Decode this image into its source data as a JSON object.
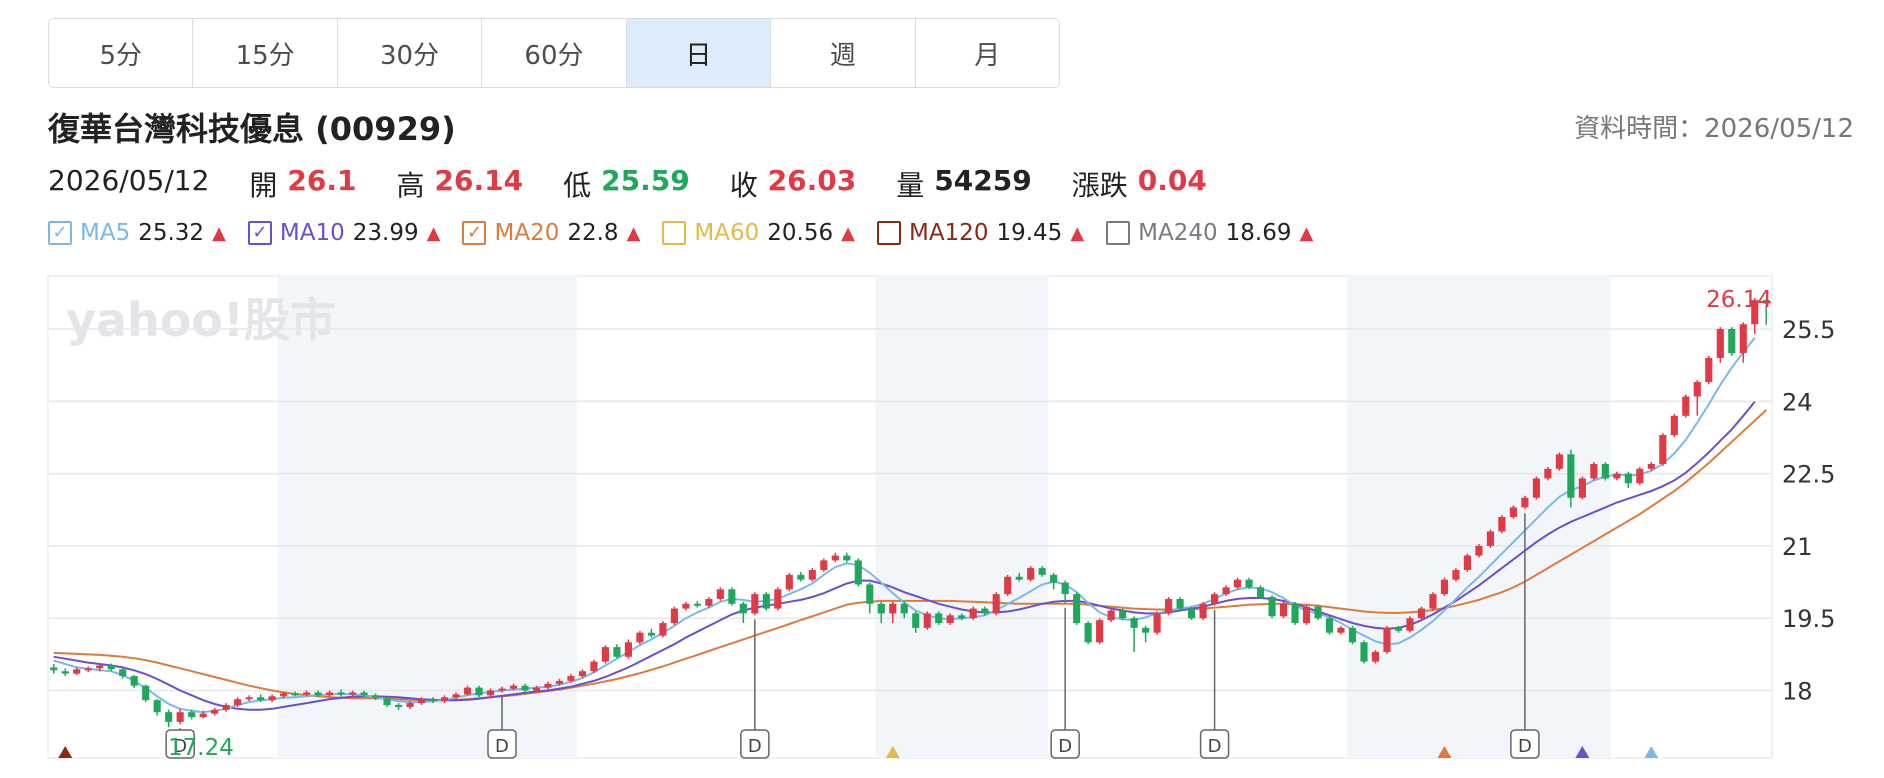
{
  "tabs": [
    {
      "label": "5分",
      "active": false
    },
    {
      "label": "15分",
      "active": false
    },
    {
      "label": "30分",
      "active": false
    },
    {
      "label": "60分",
      "active": false
    },
    {
      "label": "日",
      "active": true
    },
    {
      "label": "週",
      "active": false
    },
    {
      "label": "月",
      "active": false
    }
  ],
  "stock": {
    "title": "復華台灣科技優息 (00929)",
    "timestamp_label": "資料時間：2026/05/12"
  },
  "quote": {
    "date": "2026/05/12",
    "open_label": "開",
    "open": "26.1",
    "high_label": "高",
    "high": "26.14",
    "low_label": "低",
    "low": "25.59",
    "close_label": "收",
    "close": "26.03",
    "volume_label": "量",
    "volume": "54259",
    "change_label": "漲跌",
    "change": "0.04"
  },
  "legend": [
    {
      "name": "MA5",
      "value": "25.32",
      "checked": true,
      "color": "#7ab8ea"
    },
    {
      "name": "MA10",
      "value": "23.99",
      "checked": true,
      "color": "#6a4fd0"
    },
    {
      "name": "MA20",
      "value": "22.8",
      "checked": true,
      "color": "#e07a3a"
    },
    {
      "name": "MA60",
      "value": "20.56",
      "checked": false,
      "color": "#e6b84a"
    },
    {
      "name": "MA120",
      "value": "19.45",
      "checked": false,
      "color": "#8a2a12"
    },
    {
      "name": "MA240",
      "value": "18.69",
      "checked": false,
      "color": "#777b80"
    }
  ],
  "colors": {
    "up": "#e03a44",
    "down": "#1fa85a",
    "dark": "#222222",
    "band": "#f2f6fa",
    "grid": "#e4e8ec"
  },
  "watermark": "yahoo!股市",
  "chart_data": {
    "type": "candlestick",
    "ylim": [
      16.6,
      26.6
    ],
    "yticks": [
      "18",
      "19.5",
      "21",
      "22.5",
      "24",
      "25.5"
    ],
    "max_label": "26.14",
    "min_label": "17.24",
    "candles": [
      [
        18.48,
        18.42,
        18.55,
        18.35
      ],
      [
        18.4,
        18.35,
        18.46,
        18.3
      ],
      [
        18.35,
        18.44,
        18.48,
        18.32
      ],
      [
        18.42,
        18.46,
        18.5,
        18.38
      ],
      [
        18.46,
        18.52,
        18.56,
        18.4
      ],
      [
        18.52,
        18.44,
        18.56,
        18.4
      ],
      [
        18.44,
        18.3,
        18.46,
        18.25
      ],
      [
        18.3,
        18.1,
        18.32,
        18.05
      ],
      [
        18.1,
        17.8,
        18.12,
        17.76
      ],
      [
        17.8,
        17.55,
        17.82,
        17.48
      ],
      [
        17.55,
        17.35,
        17.6,
        17.24
      ],
      [
        17.35,
        17.55,
        17.62,
        17.3
      ],
      [
        17.55,
        17.45,
        17.6,
        17.4
      ],
      [
        17.45,
        17.52,
        17.58,
        17.42
      ],
      [
        17.52,
        17.6,
        17.64,
        17.48
      ],
      [
        17.6,
        17.7,
        17.74,
        17.56
      ],
      [
        17.7,
        17.82,
        17.86,
        17.66
      ],
      [
        17.82,
        17.86,
        17.9,
        17.78
      ],
      [
        17.86,
        17.8,
        17.92,
        17.76
      ],
      [
        17.8,
        17.88,
        17.92,
        17.76
      ],
      [
        17.88,
        17.94,
        17.98,
        17.84
      ],
      [
        17.94,
        17.92,
        17.98,
        17.88
      ],
      [
        17.92,
        17.96,
        18.0,
        17.88
      ],
      [
        17.96,
        17.9,
        18.0,
        17.86
      ],
      [
        17.9,
        17.96,
        18.0,
        17.86
      ],
      [
        17.96,
        17.92,
        18.02,
        17.88
      ],
      [
        17.92,
        17.96,
        18.0,
        17.88
      ],
      [
        17.96,
        17.9,
        18.0,
        17.86
      ],
      [
        17.9,
        17.84,
        17.94,
        17.8
      ],
      [
        17.84,
        17.7,
        17.86,
        17.66
      ],
      [
        17.7,
        17.66,
        17.74,
        17.6
      ],
      [
        17.66,
        17.74,
        17.78,
        17.62
      ],
      [
        17.74,
        17.82,
        17.86,
        17.7
      ],
      [
        17.82,
        17.78,
        17.86,
        17.74
      ],
      [
        17.78,
        17.86,
        17.9,
        17.74
      ],
      [
        17.86,
        17.92,
        17.96,
        17.82
      ],
      [
        17.92,
        18.06,
        18.1,
        17.9
      ],
      [
        18.06,
        17.9,
        18.1,
        17.86
      ],
      [
        17.9,
        18.0,
        18.04,
        17.86
      ],
      [
        18.0,
        18.04,
        18.08,
        17.96
      ],
      [
        18.04,
        18.1,
        18.14,
        18.0
      ],
      [
        18.1,
        18.0,
        18.14,
        17.96
      ],
      [
        18.0,
        18.06,
        18.1,
        17.96
      ],
      [
        18.06,
        18.14,
        18.18,
        18.02
      ],
      [
        18.14,
        18.2,
        18.24,
        18.1
      ],
      [
        18.2,
        18.3,
        18.34,
        18.16
      ],
      [
        18.3,
        18.4,
        18.44,
        18.26
      ],
      [
        18.4,
        18.6,
        18.64,
        18.36
      ],
      [
        18.6,
        18.9,
        18.94,
        18.56
      ],
      [
        18.9,
        18.7,
        18.96,
        18.66
      ],
      [
        18.7,
        19.0,
        19.06,
        18.66
      ],
      [
        19.0,
        19.2,
        19.24,
        18.96
      ],
      [
        19.2,
        19.14,
        19.28,
        19.1
      ],
      [
        19.14,
        19.4,
        19.44,
        19.1
      ],
      [
        19.4,
        19.7,
        19.74,
        19.36
      ],
      [
        19.7,
        19.8,
        19.84,
        19.66
      ],
      [
        19.8,
        19.76,
        19.86,
        19.72
      ],
      [
        19.76,
        19.9,
        19.94,
        19.72
      ],
      [
        19.9,
        20.1,
        20.14,
        19.86
      ],
      [
        20.1,
        19.8,
        20.14,
        19.76
      ],
      [
        19.8,
        19.6,
        19.84,
        19.4
      ],
      [
        19.6,
        20.0,
        20.04,
        19.56
      ],
      [
        20.0,
        19.7,
        20.04,
        19.66
      ],
      [
        19.7,
        20.1,
        20.14,
        19.66
      ],
      [
        20.1,
        20.4,
        20.44,
        20.06
      ],
      [
        20.4,
        20.3,
        20.46,
        20.26
      ],
      [
        20.3,
        20.5,
        20.54,
        20.26
      ],
      [
        20.5,
        20.7,
        20.74,
        20.46
      ],
      [
        20.7,
        20.8,
        20.86,
        20.66
      ],
      [
        20.8,
        20.7,
        20.86,
        20.66
      ],
      [
        20.7,
        20.2,
        20.74,
        20.16
      ],
      [
        20.2,
        19.8,
        20.24,
        19.6
      ],
      [
        19.8,
        19.6,
        19.84,
        19.4
      ],
      [
        19.6,
        19.8,
        19.84,
        19.4
      ],
      [
        19.8,
        19.6,
        19.84,
        19.5
      ],
      [
        19.6,
        19.3,
        19.64,
        19.2
      ],
      [
        19.3,
        19.6,
        19.64,
        19.26
      ],
      [
        19.6,
        19.4,
        19.64,
        19.36
      ],
      [
        19.4,
        19.56,
        19.6,
        19.36
      ],
      [
        19.56,
        19.5,
        19.6,
        19.46
      ],
      [
        19.5,
        19.7,
        19.74,
        19.46
      ],
      [
        19.7,
        19.6,
        19.74,
        19.56
      ],
      [
        19.6,
        20.0,
        20.04,
        19.56
      ],
      [
        20.0,
        20.36,
        20.4,
        19.96
      ],
      [
        20.36,
        20.3,
        20.44,
        20.26
      ],
      [
        20.3,
        20.54,
        20.58,
        20.26
      ],
      [
        20.54,
        20.4,
        20.58,
        20.36
      ],
      [
        20.4,
        20.24,
        20.44,
        20.1
      ],
      [
        20.24,
        20.0,
        20.28,
        19.8
      ],
      [
        20.0,
        19.4,
        20.04,
        19.36
      ],
      [
        19.4,
        19.0,
        19.44,
        18.96
      ],
      [
        19.0,
        19.46,
        19.5,
        18.96
      ],
      [
        19.46,
        19.66,
        19.7,
        19.42
      ],
      [
        19.66,
        19.5,
        19.7,
        19.46
      ],
      [
        19.5,
        19.3,
        19.54,
        18.8
      ],
      [
        19.3,
        19.2,
        19.34,
        19.0
      ],
      [
        19.2,
        19.6,
        19.64,
        19.16
      ],
      [
        19.6,
        19.9,
        19.94,
        19.56
      ],
      [
        19.9,
        19.7,
        19.94,
        19.66
      ],
      [
        19.7,
        19.5,
        19.74,
        19.46
      ],
      [
        19.5,
        19.8,
        19.84,
        19.46
      ],
      [
        19.8,
        20.0,
        20.04,
        19.76
      ],
      [
        20.0,
        20.14,
        20.18,
        19.96
      ],
      [
        20.14,
        20.3,
        20.34,
        20.1
      ],
      [
        20.3,
        20.14,
        20.34,
        20.1
      ],
      [
        20.14,
        19.94,
        20.18,
        19.9
      ],
      [
        19.94,
        19.54,
        19.98,
        19.5
      ],
      [
        19.54,
        19.8,
        19.84,
        19.5
      ],
      [
        19.8,
        19.4,
        19.84,
        19.36
      ],
      [
        19.4,
        19.74,
        19.78,
        19.36
      ],
      [
        19.74,
        19.5,
        19.78,
        19.46
      ],
      [
        19.5,
        19.2,
        19.54,
        19.16
      ],
      [
        19.2,
        19.3,
        19.34,
        19.16
      ],
      [
        19.3,
        19.0,
        19.34,
        18.96
      ],
      [
        19.0,
        18.6,
        19.04,
        18.56
      ],
      [
        18.6,
        18.8,
        18.84,
        18.56
      ],
      [
        18.8,
        19.3,
        19.34,
        18.76
      ],
      [
        19.3,
        19.24,
        19.34,
        19.2
      ],
      [
        19.24,
        19.5,
        19.54,
        19.2
      ],
      [
        19.5,
        19.7,
        19.74,
        19.46
      ],
      [
        19.7,
        20.0,
        20.04,
        19.66
      ],
      [
        20.0,
        20.3,
        20.34,
        19.96
      ],
      [
        20.3,
        20.5,
        20.54,
        20.26
      ],
      [
        20.5,
        20.8,
        20.84,
        20.46
      ],
      [
        20.8,
        21.0,
        21.04,
        20.76
      ],
      [
        21.0,
        21.3,
        21.34,
        20.96
      ],
      [
        21.3,
        21.6,
        21.64,
        21.26
      ],
      [
        21.6,
        21.8,
        21.84,
        21.56
      ],
      [
        21.8,
        22.0,
        22.04,
        21.76
      ],
      [
        22.0,
        22.4,
        22.44,
        21.96
      ],
      [
        22.4,
        22.6,
        22.64,
        22.36
      ],
      [
        22.6,
        22.9,
        22.94,
        22.56
      ],
      [
        22.9,
        22.0,
        23.0,
        21.8
      ],
      [
        22.0,
        22.4,
        22.44,
        21.96
      ],
      [
        22.4,
        22.7,
        22.74,
        22.36
      ],
      [
        22.7,
        22.4,
        22.74,
        22.36
      ],
      [
        22.4,
        22.5,
        22.54,
        22.36
      ],
      [
        22.5,
        22.3,
        22.54,
        22.2
      ],
      [
        22.3,
        22.6,
        22.64,
        22.26
      ],
      [
        22.6,
        22.7,
        22.74,
        22.56
      ],
      [
        22.7,
        23.3,
        23.34,
        22.66
      ],
      [
        23.3,
        23.7,
        23.74,
        23.26
      ],
      [
        23.7,
        24.1,
        24.14,
        23.66
      ],
      [
        24.1,
        24.4,
        24.44,
        23.7
      ],
      [
        24.4,
        24.9,
        24.94,
        24.36
      ],
      [
        24.9,
        25.5,
        25.54,
        24.8
      ],
      [
        25.5,
        25.0,
        25.54,
        24.94
      ],
      [
        25.0,
        25.6,
        25.64,
        24.8
      ],
      [
        25.6,
        26.1,
        26.14,
        25.4
      ],
      [
        26.1,
        26.03,
        26.14,
        25.59
      ]
    ],
    "ma5": [
      18.62,
      18.55,
      18.48,
      18.45,
      18.42,
      18.4,
      18.32,
      18.2,
      18.05,
      17.88,
      17.72,
      17.62,
      17.58,
      17.55,
      17.58,
      17.62,
      17.7,
      17.76,
      17.8,
      17.82,
      17.85,
      17.86,
      17.88,
      17.9,
      17.92,
      17.93,
      17.92,
      17.9,
      17.86,
      17.82,
      17.78,
      17.76,
      17.76,
      17.78,
      17.8,
      17.86,
      17.9,
      17.94,
      17.97,
      18.0,
      18.02,
      18.04,
      18.06,
      18.08,
      18.12,
      18.18,
      18.26,
      18.38,
      18.52,
      18.66,
      18.8,
      18.94,
      19.06,
      19.2,
      19.34,
      19.5,
      19.62,
      19.72,
      19.84,
      19.9,
      19.88,
      19.84,
      19.86,
      19.9,
      20.0,
      20.1,
      20.22,
      20.4,
      20.56,
      20.64,
      20.6,
      20.44,
      20.24,
      20.02,
      19.82,
      19.66,
      19.56,
      19.5,
      19.48,
      19.5,
      19.52,
      19.56,
      19.66,
      19.8,
      19.92,
      20.06,
      20.2,
      20.26,
      20.2,
      20.04,
      19.82,
      19.62,
      19.52,
      19.48,
      19.46,
      19.52,
      19.6,
      19.66,
      19.7,
      19.74,
      19.8,
      19.9,
      20.02,
      20.1,
      20.14,
      20.12,
      20.04,
      19.92,
      19.76,
      19.66,
      19.6,
      19.52,
      19.4,
      19.26,
      19.14,
      19.02,
      18.96,
      18.98,
      19.1,
      19.26,
      19.44,
      19.66,
      19.9,
      20.14,
      20.36,
      20.6,
      20.84,
      21.08,
      21.32,
      21.56,
      21.8,
      22.02,
      22.16,
      22.24,
      22.36,
      22.44,
      22.48,
      22.46,
      22.48,
      22.56,
      22.7,
      22.92,
      23.2,
      23.56,
      23.94,
      24.34,
      24.7,
      25.02,
      25.32
    ],
    "ma10": [
      18.7,
      18.66,
      18.62,
      18.58,
      18.55,
      18.52,
      18.48,
      18.42,
      18.34,
      18.24,
      18.12,
      18.0,
      17.9,
      17.8,
      17.72,
      17.66,
      17.62,
      17.6,
      17.6,
      17.62,
      17.66,
      17.7,
      17.74,
      17.78,
      17.82,
      17.85,
      17.87,
      17.88,
      17.88,
      17.87,
      17.86,
      17.84,
      17.82,
      17.81,
      17.8,
      17.8,
      17.81,
      17.83,
      17.86,
      17.89,
      17.92,
      17.95,
      17.98,
      18.0,
      18.04,
      18.08,
      18.14,
      18.2,
      18.28,
      18.38,
      18.48,
      18.6,
      18.72,
      18.84,
      18.96,
      19.1,
      19.22,
      19.34,
      19.46,
      19.58,
      19.66,
      19.72,
      19.76,
      19.8,
      19.84,
      19.88,
      19.94,
      20.02,
      20.12,
      20.22,
      20.28,
      20.28,
      20.22,
      20.14,
      20.04,
      19.96,
      19.88,
      19.8,
      19.74,
      19.68,
      19.64,
      19.62,
      19.62,
      19.64,
      19.68,
      19.74,
      19.8,
      19.84,
      19.86,
      19.86,
      19.82,
      19.76,
      19.7,
      19.66,
      19.62,
      19.6,
      19.6,
      19.62,
      19.66,
      19.7,
      19.74,
      19.8,
      19.86,
      19.9,
      19.92,
      19.92,
      19.9,
      19.86,
      19.8,
      19.72,
      19.64,
      19.56,
      19.48,
      19.4,
      19.34,
      19.3,
      19.28,
      19.3,
      19.36,
      19.46,
      19.58,
      19.72,
      19.86,
      20.02,
      20.18,
      20.36,
      20.54,
      20.72,
      20.9,
      21.08,
      21.24,
      21.38,
      21.5,
      21.6,
      21.7,
      21.8,
      21.9,
      21.98,
      22.06,
      22.14,
      22.24,
      22.36,
      22.52,
      22.72,
      22.94,
      23.18,
      23.42,
      23.7,
      23.99
    ],
    "ma20": [
      18.78,
      18.77,
      18.76,
      18.75,
      18.74,
      18.72,
      18.7,
      18.67,
      18.63,
      18.58,
      18.52,
      18.46,
      18.4,
      18.34,
      18.28,
      18.22,
      18.16,
      18.1,
      18.05,
      18.0,
      17.96,
      17.93,
      17.9,
      17.88,
      17.86,
      17.85,
      17.84,
      17.84,
      17.84,
      17.83,
      17.82,
      17.81,
      17.8,
      17.8,
      17.8,
      17.81,
      17.82,
      17.84,
      17.86,
      17.88,
      17.9,
      17.93,
      17.96,
      17.99,
      18.02,
      18.06,
      18.1,
      18.14,
      18.19,
      18.24,
      18.3,
      18.36,
      18.43,
      18.5,
      18.58,
      18.66,
      18.74,
      18.82,
      18.9,
      18.98,
      19.06,
      19.14,
      19.22,
      19.3,
      19.38,
      19.46,
      19.54,
      19.62,
      19.7,
      19.78,
      19.82,
      19.84,
      19.86,
      19.86,
      19.86,
      19.86,
      19.86,
      19.86,
      19.86,
      19.85,
      19.84,
      19.83,
      19.82,
      19.81,
      19.8,
      19.8,
      19.8,
      19.8,
      19.8,
      19.8,
      19.78,
      19.76,
      19.74,
      19.72,
      19.7,
      19.69,
      19.68,
      19.68,
      19.68,
      19.69,
      19.7,
      19.72,
      19.74,
      19.76,
      19.78,
      19.79,
      19.8,
      19.8,
      19.79,
      19.78,
      19.76,
      19.73,
      19.7,
      19.67,
      19.64,
      19.62,
      19.61,
      19.61,
      19.62,
      19.64,
      19.67,
      19.71,
      19.76,
      19.82,
      19.88,
      19.96,
      20.04,
      20.14,
      20.26,
      20.4,
      20.54,
      20.68,
      20.82,
      20.96,
      21.1,
      21.24,
      21.38,
      21.52,
      21.66,
      21.82,
      21.98,
      22.14,
      22.32,
      22.52,
      22.72,
      22.94,
      23.16,
      23.38,
      23.6,
      23.82,
      22.8
    ],
    "dividend_markers": [
      {
        "label": "D",
        "index": 11
      },
      {
        "label": "D",
        "index": 39
      },
      {
        "label": "D",
        "index": 61
      },
      {
        "label": "D",
        "index": 88
      },
      {
        "label": "D",
        "index": 101
      },
      {
        "label": "D",
        "index": 128
      }
    ],
    "ma_cross_markers": [
      {
        "index": 1,
        "color": "#8a2a12"
      },
      {
        "index": 73,
        "color": "#e6b84a"
      },
      {
        "index": 121,
        "color": "#e07a3a"
      },
      {
        "index": 133,
        "color": "#6a4fd0"
      },
      {
        "index": 139,
        "color": "#7ab8ea"
      }
    ],
    "shaded_bands": [
      [
        20,
        46
      ],
      [
        72,
        87
      ],
      [
        113,
        136
      ]
    ]
  }
}
